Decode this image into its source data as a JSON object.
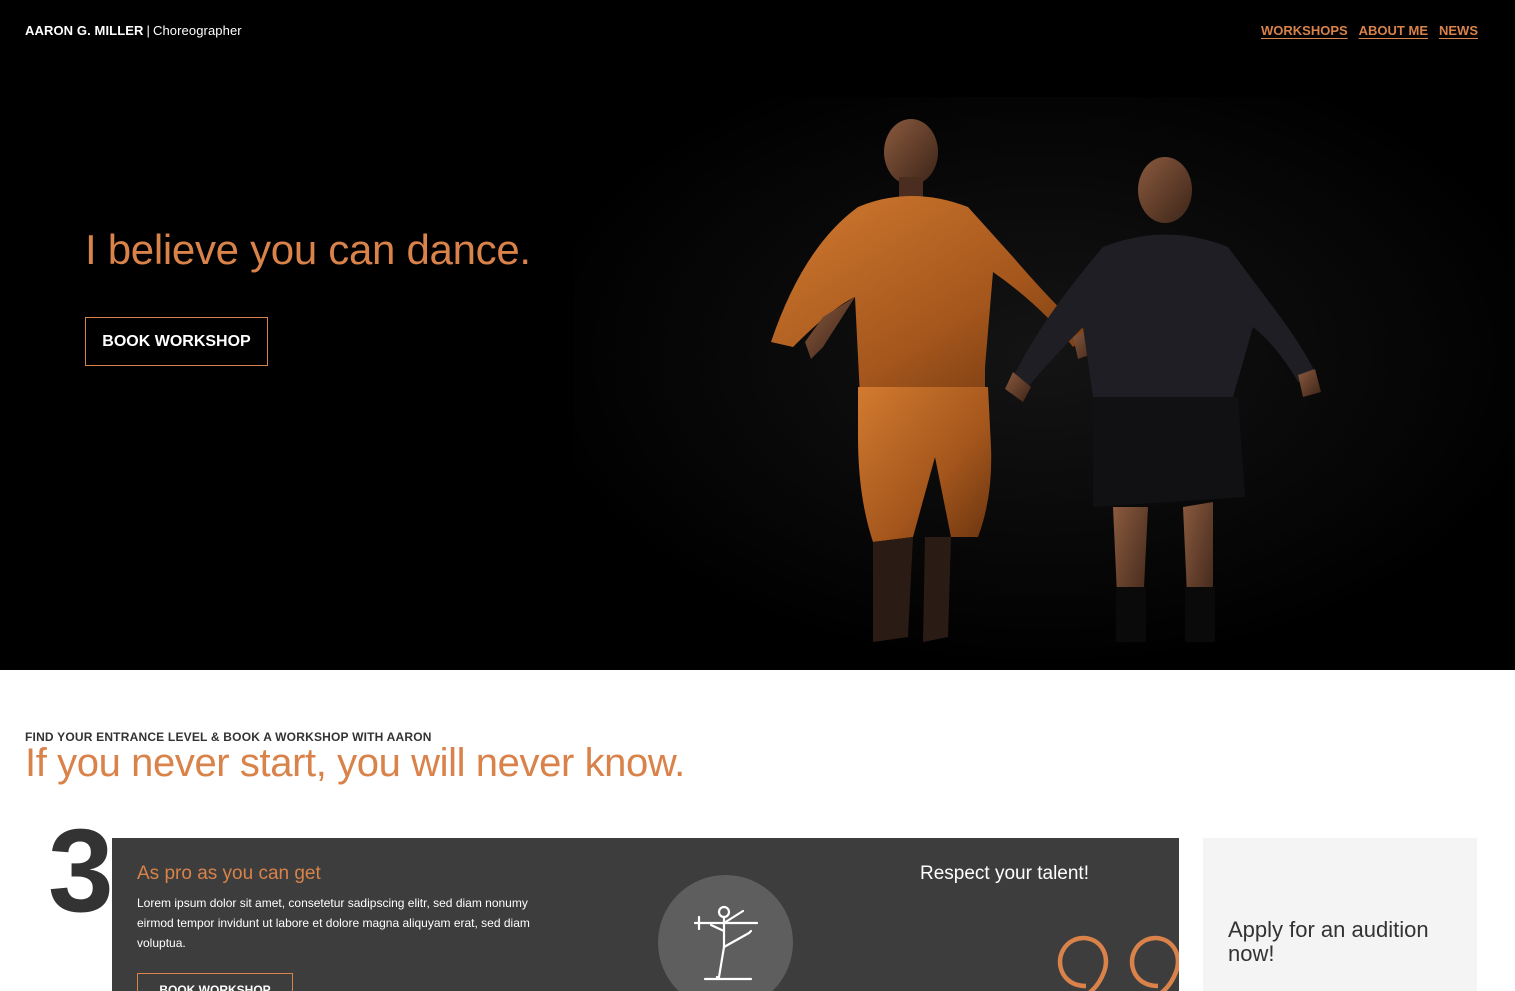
{
  "header": {
    "brand_name": "AARON G. MILLER",
    "brand_separator": "|",
    "brand_role": "Choreographer",
    "nav": [
      "WORKSHOPS",
      "ABOUT ME",
      "NEWS"
    ]
  },
  "hero": {
    "heading": "I believe you can dance.",
    "cta_label": "BOOK WORKSHOP"
  },
  "section": {
    "eyebrow": "FIND YOUR ENTRANCE LEVEL & BOOK A WORKSHOP WITH AARON",
    "heading": "If you never start, you will never know."
  },
  "level_card": {
    "number": "3",
    "title": "As pro as you can get",
    "text": "Lorem ipsum dolor sit amet, consetetur sadipscing elitr, sed diam nonumy eirmod tempor invidunt ut labore et dolore magna aliquyam erat, sed diam voluptua.",
    "cta_label": "BOOK WORKSHOP",
    "icon": "dancer-barre-icon",
    "quote_title": "Respect your talent!",
    "quote_icon": "quote-marks-icon"
  },
  "aside": {
    "text": "Apply for an audition now!"
  },
  "colors": {
    "accent": "#d9824a",
    "hero_bg": "#000000",
    "card_bg": "#3d3d3d",
    "aside_bg": "#f4f4f4"
  }
}
